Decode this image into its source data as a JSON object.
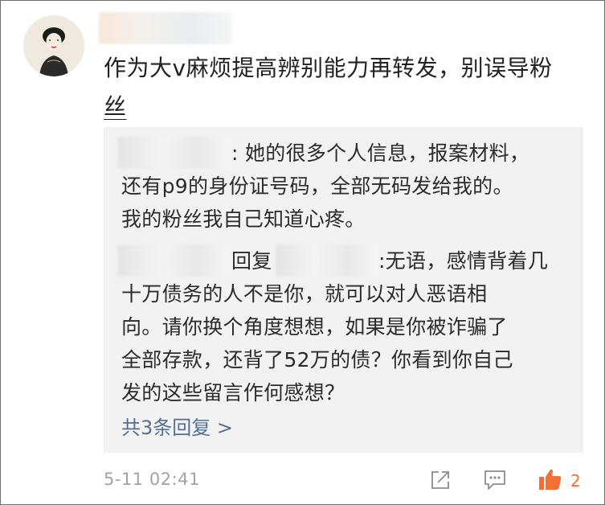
{
  "comment": {
    "text_line1": "作为大v麻烦提高辨别能力再转发，别误导粉",
    "text_line2": "丝",
    "timestamp": "5-11 02:41",
    "like_count": "2"
  },
  "replies": {
    "first": {
      "lines": [
        ": 她的很多个人信息，报案材料，",
        "还有p9的身份证号码，全部无码发给我的。",
        "我的粉丝我自己知道心疼。"
      ]
    },
    "second": {
      "reply_word": "回复",
      "lines": [
        ":无语，感情背着几",
        "十万债务的人不是你，就可以对人恶语相",
        "向。请你换个角度想想，如果是你被诈骗了",
        "全部存款，还背了52万的债？你看到你自己",
        "发的这些留言作何感想？"
      ]
    },
    "more_link": "共3条回复 >"
  },
  "icons": {
    "share": "share-icon",
    "comment": "comment-icon",
    "like": "thumbs-up-icon"
  },
  "colors": {
    "link": "#556e94",
    "like": "#f27036",
    "reply_bg": "#f2f2f2"
  }
}
